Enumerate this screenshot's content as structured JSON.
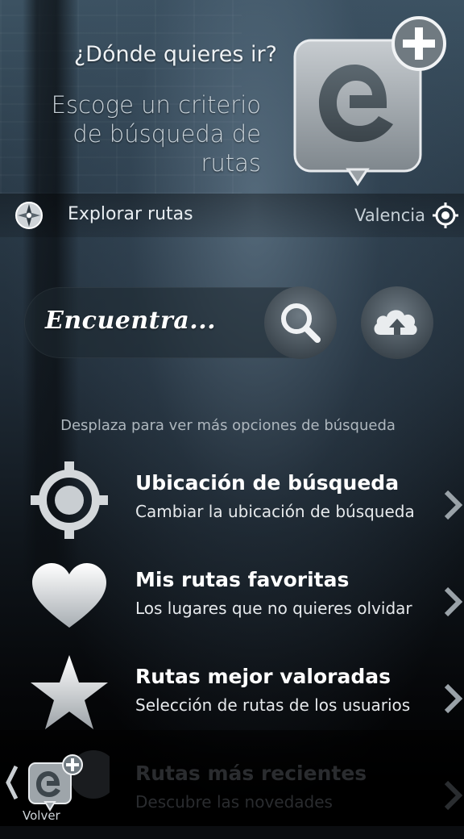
{
  "header": {
    "question": "¿Dónde quieres ir?",
    "subtitle": "Escoge un criterio de búsqueda de rutas"
  },
  "location_row": {
    "explore_label": "Explorar rutas",
    "city": "Valencia"
  },
  "search": {
    "placeholder": "Encuentra..."
  },
  "hint": "Desplaza para ver más opciones de búsqueda",
  "items": [
    {
      "title": "Ubicación de búsqueda",
      "subtitle": "Cambiar la ubicación de búsqueda",
      "icon": "crosshair-icon"
    },
    {
      "title": "Mis rutas favoritas",
      "subtitle": "Los lugares que no quieres olvidar",
      "icon": "heart-icon"
    },
    {
      "title": "Rutas mejor valoradas",
      "subtitle": "Selección de rutas de los usuarios",
      "icon": "star-icon"
    },
    {
      "title": "Rutas más recientes",
      "subtitle": "Descubre las novedades",
      "icon": "clock-icon"
    }
  ],
  "back": {
    "label": "Volver"
  },
  "colors": {
    "accent": "#ffffff",
    "icon_grey": "#c9ced2"
  }
}
